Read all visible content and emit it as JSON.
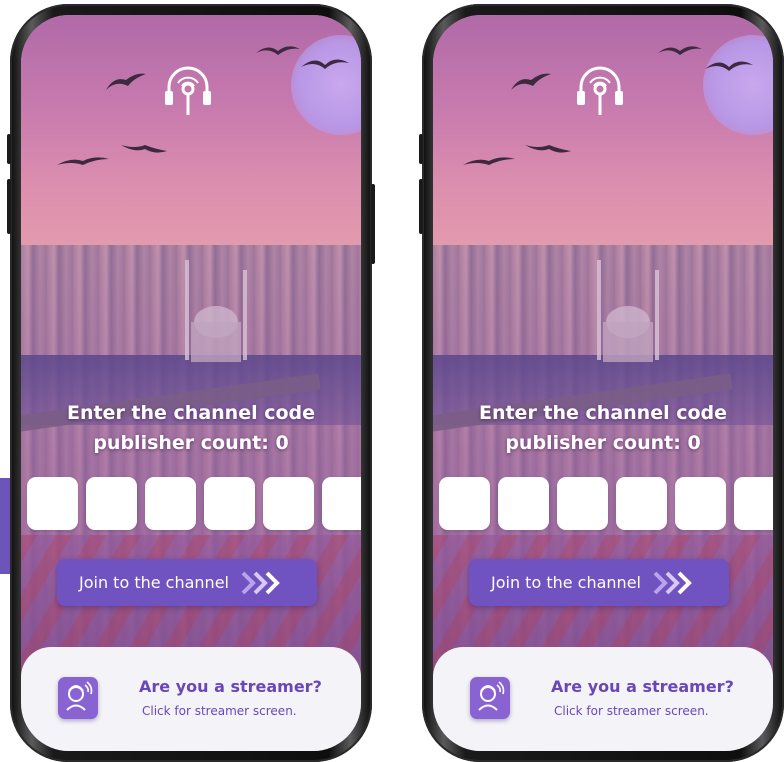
{
  "screens": [
    {
      "title_line1": "Enter the channel code",
      "title_line2": "publisher count: 0",
      "code_boxes": [
        "",
        "",
        "",
        "",
        "",
        ""
      ],
      "join_button_label": "Join to the channel",
      "streamer_title": "Are you a streamer?",
      "streamer_subtitle": "Click for streamer screen."
    },
    {
      "title_line1": "Enter the channel code",
      "title_line2": "publisher count: 0",
      "code_boxes": [
        "",
        "",
        "",
        "",
        "",
        ""
      ],
      "join_button_label": "Join to the channel",
      "streamer_title": "Are you a streamer?",
      "streamer_subtitle": "Click for streamer screen."
    }
  ],
  "icons": {
    "logo": "headphones-pin-icon",
    "join_arrows": "triple-chevron-right-icon",
    "streamer": "broadcaster-icon"
  },
  "colors": {
    "accent": "#7052c0",
    "streamer_text": "#6848b8",
    "streamer_icon_bg": "#8a63d2",
    "card_bg": "#f4f3f7",
    "side_accent": "#6d54b8"
  }
}
